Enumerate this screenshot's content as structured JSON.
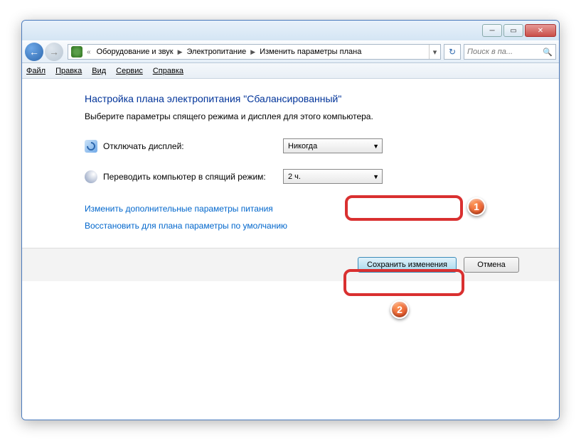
{
  "breadcrumbs": {
    "item1": "Оборудование и звук",
    "item2": "Электропитание",
    "item3": "Изменить параметры плана"
  },
  "search": {
    "placeholder": "Поиск в па..."
  },
  "menu": {
    "file": "Файл",
    "edit": "Правка",
    "view": "Вид",
    "tools": "Сервис",
    "help": "Справка"
  },
  "heading": "Настройка плана электропитания \"Сбалансированный\"",
  "subtext": "Выберите параметры спящего режима и дисплея для этого компьютера.",
  "row_display": {
    "label": "Отключать дисплей:",
    "value": "Никогда"
  },
  "row_sleep": {
    "label": "Переводить компьютер в спящий режим:",
    "value": "2 ч."
  },
  "link_advanced": "Изменить дополнительные параметры питания",
  "link_restore": "Восстановить для плана параметры по умолчанию",
  "btn_save": "Сохранить изменения",
  "btn_cancel": "Отмена",
  "callouts": {
    "n1": "1",
    "n2": "2"
  }
}
